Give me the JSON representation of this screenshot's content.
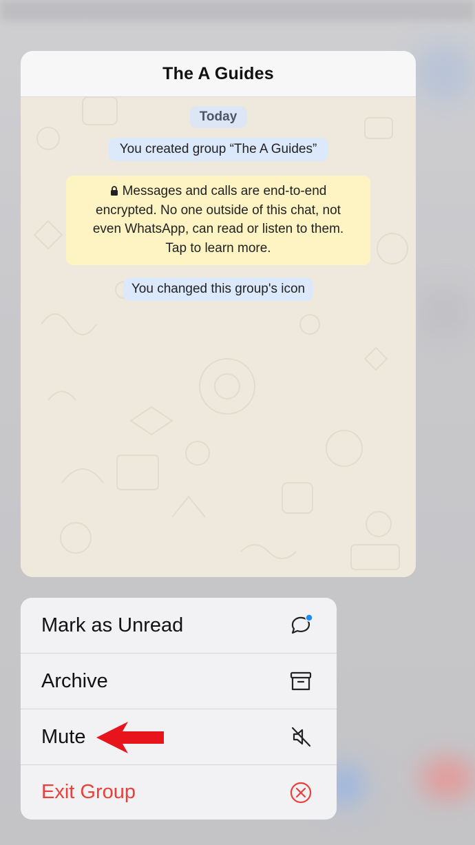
{
  "preview": {
    "title": "The A Guides",
    "date_chip": "Today",
    "system_created": "You created group “The A Guides”",
    "encryption_notice_lines": [
      "Messages and calls are end-to-end",
      "encrypted. No one outside of this chat, not",
      "even WhatsApp, can read or listen to them.",
      "Tap to learn more."
    ],
    "system_icon_changed": "You changed this group's icon"
  },
  "menu": {
    "items": [
      {
        "label": "Mark as Unread",
        "icon": "chat-bubble-unread-icon"
      },
      {
        "label": "Archive",
        "icon": "archive-box-icon"
      },
      {
        "label": "Mute",
        "icon": "speaker-muted-icon"
      },
      {
        "label": "Exit Group",
        "icon": "circle-x-icon"
      }
    ]
  },
  "annotation": {
    "arrow_color": "#e8141b",
    "points_to": "Mute"
  },
  "colors": {
    "danger": "#eb3f3a",
    "unread_dot": "#1a8cff",
    "encryption_bg": "#fdf3c3",
    "system_pill_bg": "#dbe9fb"
  }
}
